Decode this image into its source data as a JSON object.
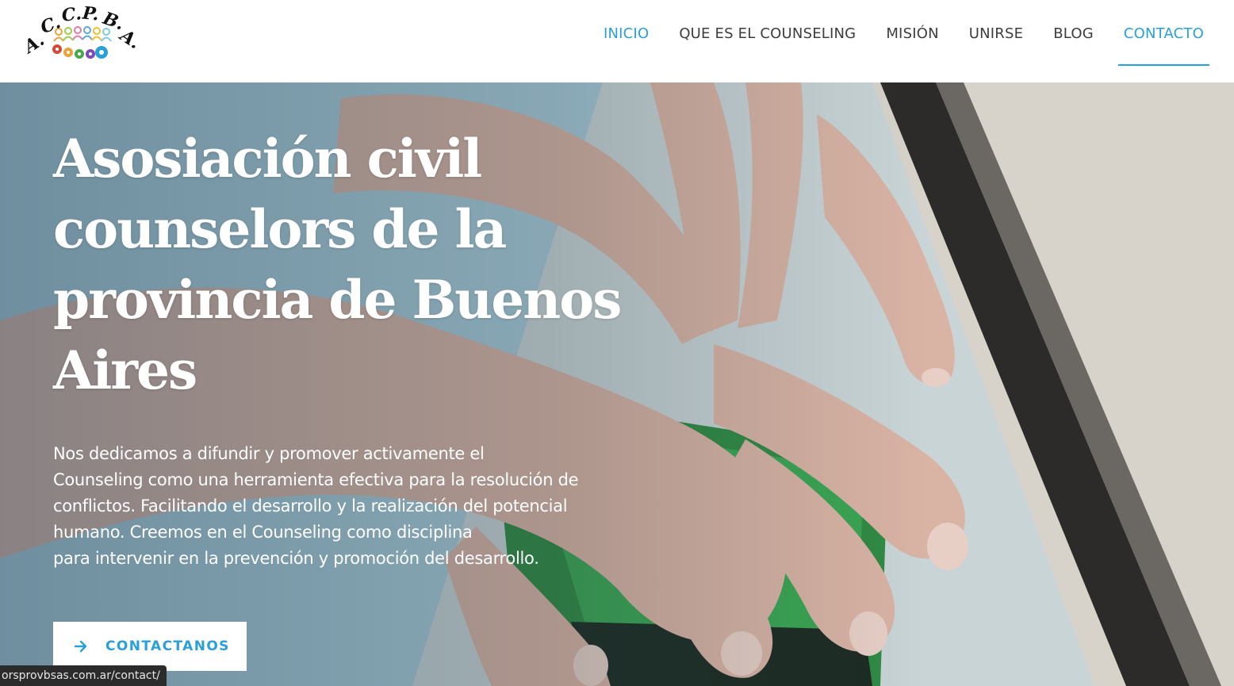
{
  "site": {
    "logo_text": "A.C.C.P.B.A."
  },
  "nav": {
    "items": [
      {
        "label": "INICIO"
      },
      {
        "label": "QUE ES EL COUNSELING"
      },
      {
        "label": "MISIÓN"
      },
      {
        "label": "UNIRSE"
      },
      {
        "label": "BLOG"
      },
      {
        "label": "CONTACTO"
      }
    ]
  },
  "hero": {
    "title_lines": [
      "Asosiación civil",
      "counselors de la",
      "provincia de Buenos",
      "Aires"
    ],
    "text_lines": [
      "Nos dedicamos a difundir y promover activamente el",
      "Counseling como una herramienta efectiva para la resolución de",
      "conflictos. Facilitando el desarrollo y la realización del potencial",
      "humano. Creemos en el Counseling como disciplina",
      "para intervenir en la prevención y promoción del desarrollo."
    ],
    "button_label": "CONTACTANOS",
    "button_icon": "arrow-right-icon"
  },
  "status_bar": {
    "url": "orsprovbsas.com.ar/contact/"
  },
  "colors": {
    "accent": "#2a9fd8",
    "nav_text": "#3d3d3d",
    "status_bar_bg": "#2b2b2b"
  }
}
